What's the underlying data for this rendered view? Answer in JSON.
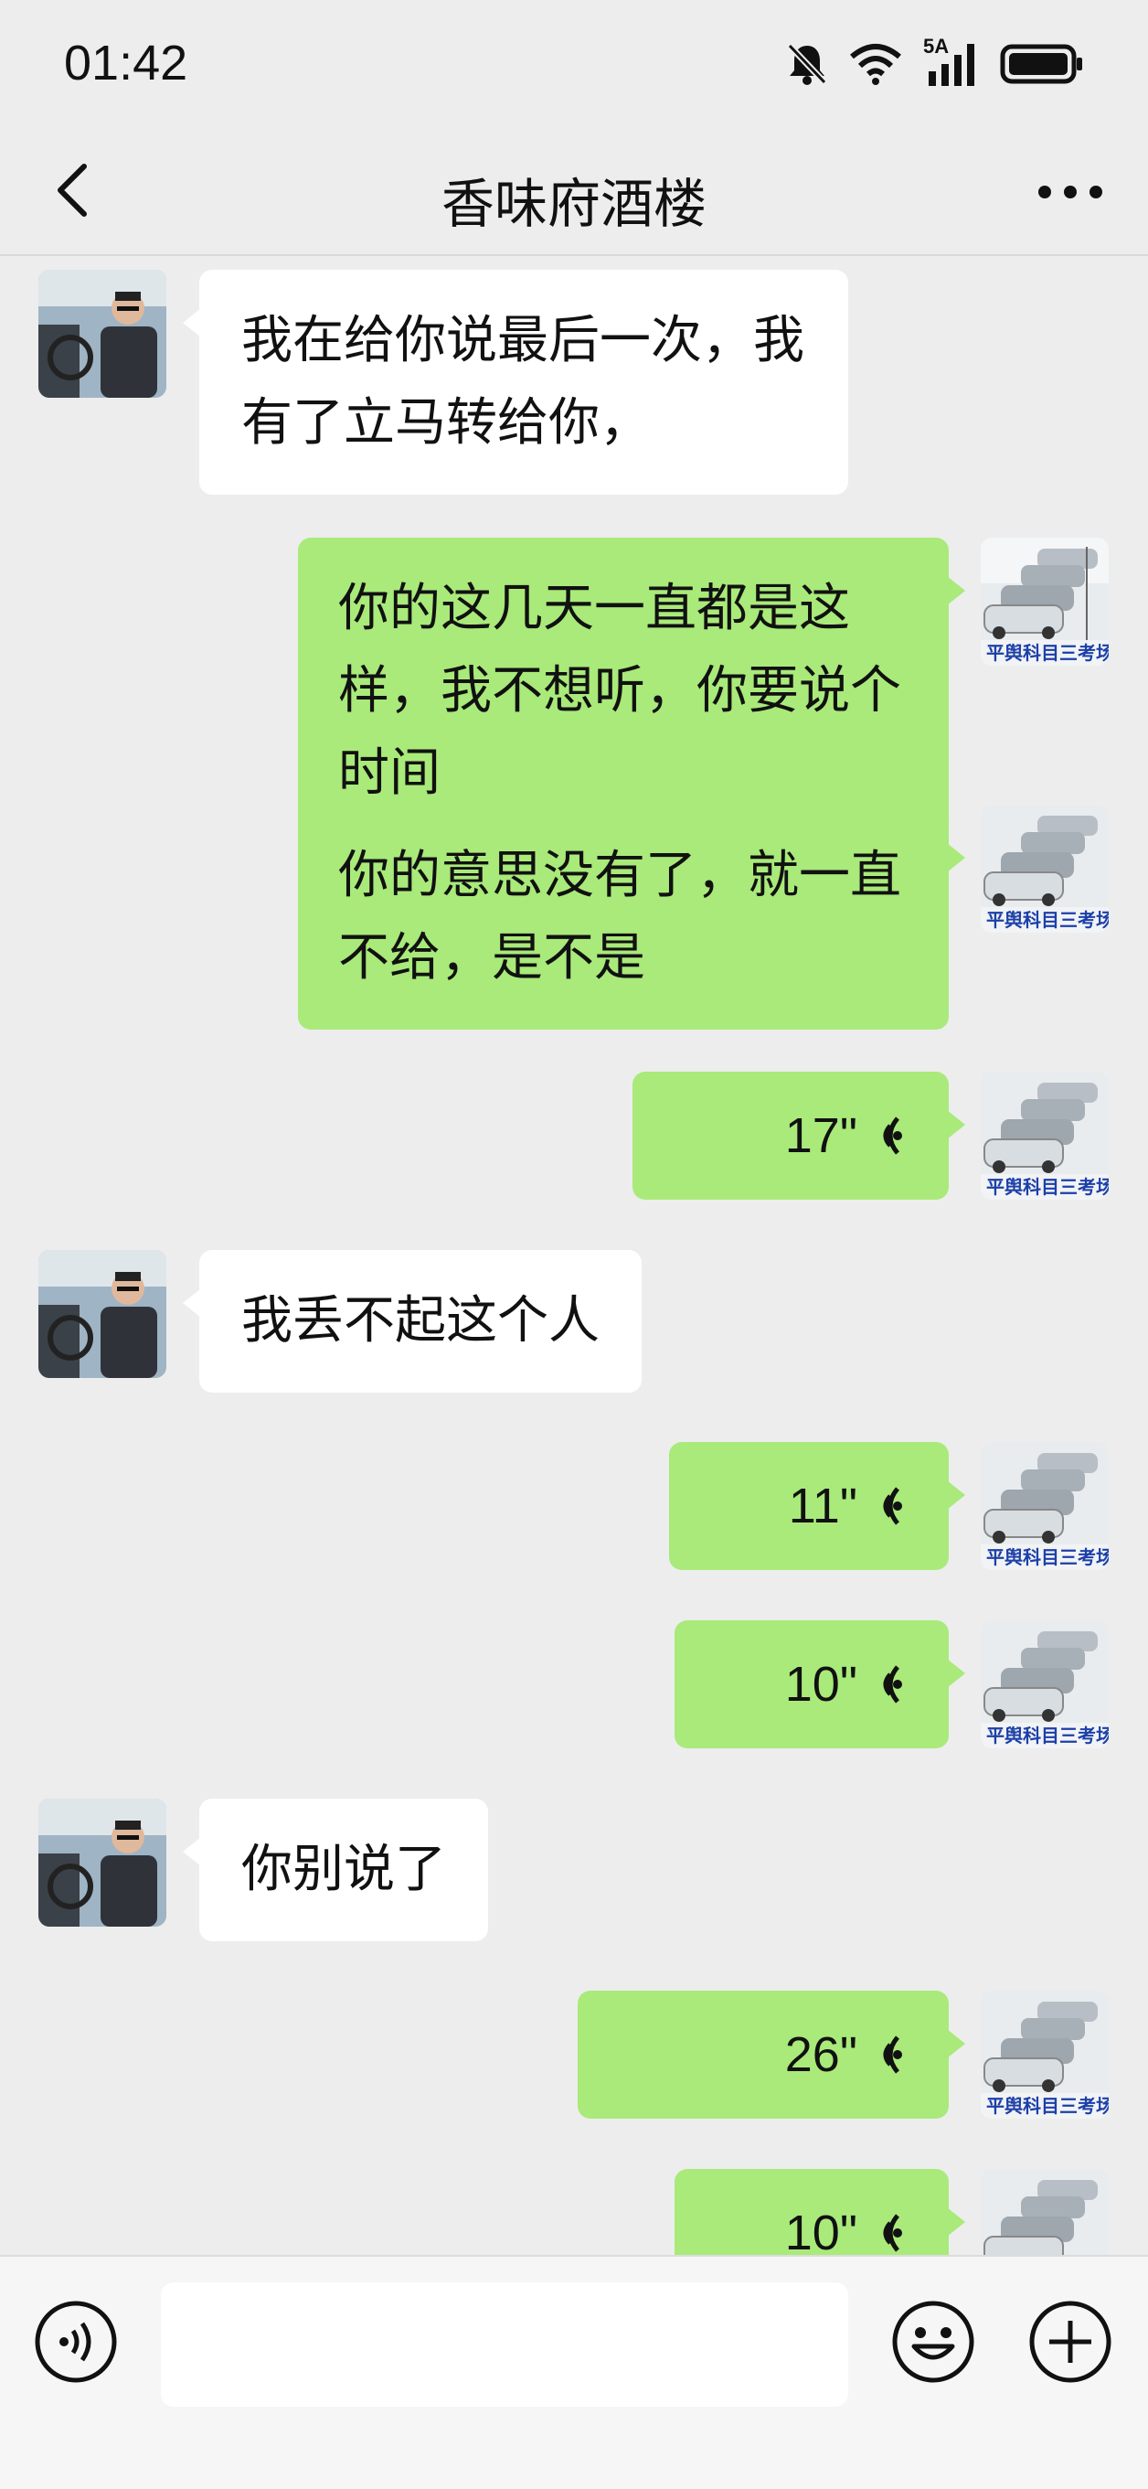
{
  "status_bar": {
    "time": "01:42",
    "network": "5A"
  },
  "nav": {
    "title": "香味府酒楼",
    "back_icon": "chevron-left-icon",
    "more_icon": "more-dots-icon"
  },
  "messages": [
    {
      "side": "in",
      "type": "text",
      "text": "我在给你说最后一次，我有了立马转给你，"
    },
    {
      "side": "out",
      "type": "text",
      "text": "你的这几天一直都是这样，我不想听，你要说个时间"
    },
    {
      "side": "out",
      "type": "text",
      "text": "你的意思没有了，就一直不给，是不是"
    },
    {
      "side": "out",
      "type": "voice",
      "duration": "17\""
    },
    {
      "side": "in",
      "type": "text",
      "text": "我丢不起这个人"
    },
    {
      "side": "out",
      "type": "voice",
      "duration": "11\""
    },
    {
      "side": "out",
      "type": "voice",
      "duration": "10\""
    },
    {
      "side": "in",
      "type": "text",
      "text": "你别说了"
    },
    {
      "side": "out",
      "type": "voice",
      "duration": "26\""
    },
    {
      "side": "out",
      "type": "voice",
      "duration": "10\""
    }
  ],
  "my_avatar_caption": "平舆科目三考场",
  "input": {
    "value": "",
    "placeholder": ""
  },
  "colors": {
    "background": "#ededed",
    "outgoing_bubble": "#a9ea7a",
    "incoming_bubble": "#ffffff"
  }
}
